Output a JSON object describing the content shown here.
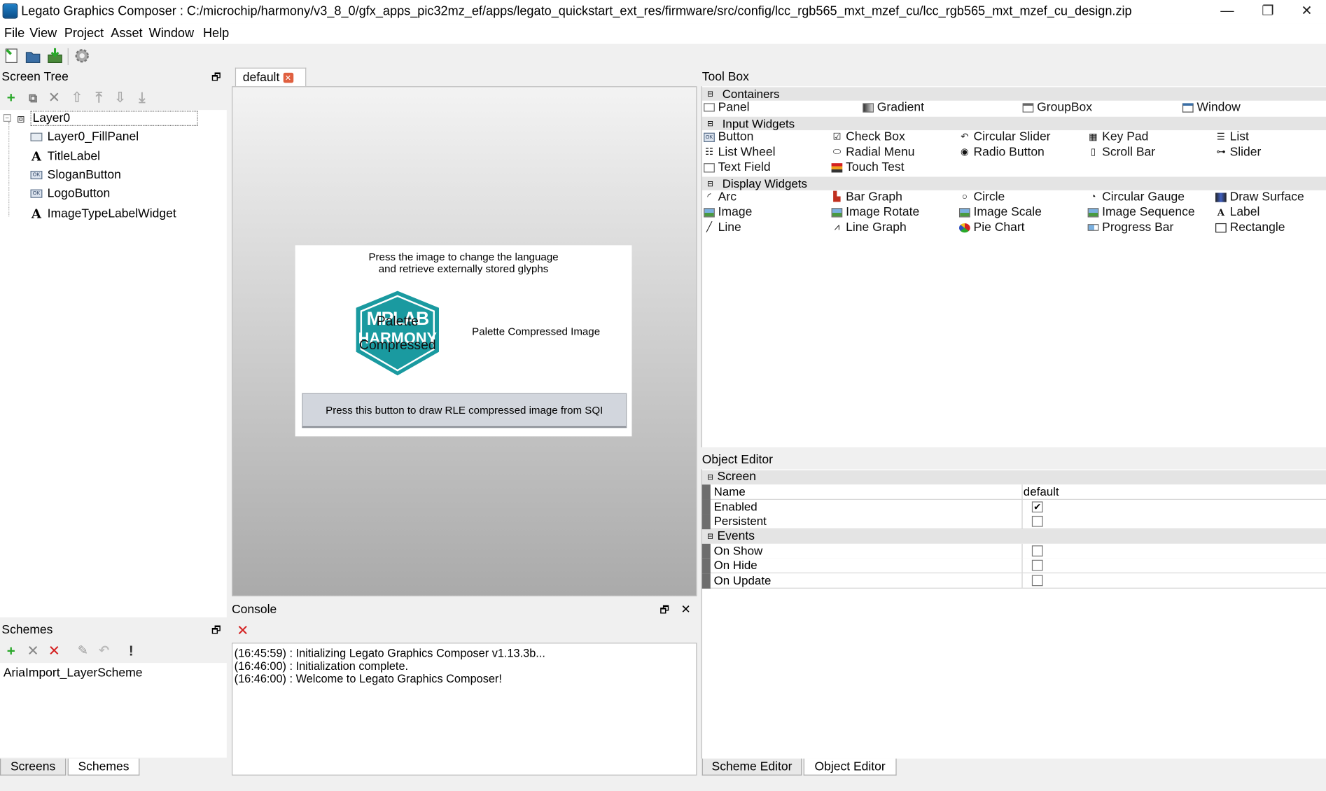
{
  "window": {
    "title": "Legato Graphics Composer : C:/microchip/harmony/v3_8_0/gfx_apps_pic32mz_ef/apps/legato_quickstart_ext_res/firmware/src/config/lcc_rgb565_mxt_mzef_cu/lcc_rgb565_mxt_mzef_cu_design.zip",
    "minimize": "—",
    "restore": "❐",
    "close": "✕"
  },
  "menu": [
    "File",
    "View",
    "Project",
    "Asset",
    "Window",
    "Help"
  ],
  "screen_tree": {
    "title": "Screen Tree",
    "nodes": [
      {
        "label": "Layer0",
        "icon": "layer-icon"
      },
      {
        "label": "Layer0_FillPanel",
        "icon": "panel-icon"
      },
      {
        "label": "TitleLabel",
        "icon": "label-icon"
      },
      {
        "label": "SloganButton",
        "icon": "button-icon"
      },
      {
        "label": "LogoButton",
        "icon": "button-icon"
      },
      {
        "label": "ImageTypeLabelWidget",
        "icon": "label-icon"
      }
    ]
  },
  "schemes": {
    "title": "Schemes",
    "items": [
      "AriaImport_LayerScheme"
    ]
  },
  "left_tabs": [
    "Screens",
    "Schemes"
  ],
  "editor": {
    "tab": "default",
    "preview": {
      "title_line1": "Press the image to change the language",
      "title_line2": "and retrieve externally stored glyphs",
      "logo_text_top": "MPLAB",
      "logo_text_bottom": "HARMONY",
      "logo_overlay_1": "Palette",
      "logo_overlay_2": "Compressed",
      "image_type_label": "Palette Compressed Image",
      "button_label": "Press this button to draw RLE compressed image from SQI"
    }
  },
  "console": {
    "title": "Console",
    "lines": [
      "(16:45:59) : Initializing Legato Graphics Composer v1.13.3b...",
      "(16:46:00) : Initialization complete.",
      "(16:46:00) : Welcome to Legato Graphics Composer!"
    ]
  },
  "toolbox": {
    "title": "Tool Box",
    "sections": [
      {
        "name": "Containers",
        "items": [
          "Panel",
          "Gradient",
          "GroupBox",
          "Window"
        ]
      },
      {
        "name": "Input Widgets",
        "items": [
          "Button",
          "Check Box",
          "Circular Slider",
          "Key Pad",
          "List",
          "List Wheel",
          "Radial Menu",
          "Radio Button",
          "Scroll Bar",
          "Slider",
          "Text Field",
          "Touch Test"
        ]
      },
      {
        "name": "Display Widgets",
        "items": [
          "Arc",
          "Bar Graph",
          "Circle",
          "Circular Gauge",
          "Draw Surface",
          "Image",
          "Image Rotate",
          "Image Scale",
          "Image Sequence",
          "Label",
          "Line",
          "Line Graph",
          "Pie Chart",
          "Progress Bar",
          "Rectangle"
        ]
      }
    ]
  },
  "object_editor": {
    "title": "Object Editor",
    "screen_section": "Screen",
    "events_section": "Events",
    "name_key": "Name",
    "name_value": "default",
    "enabled_key": "Enabled",
    "persistent_key": "Persistent",
    "on_show_key": "On Show",
    "on_hide_key": "On Hide",
    "on_update_key": "On Update",
    "check_mark": "✔"
  },
  "right_tabs": [
    "Scheme Editor",
    "Object Editor"
  ],
  "colors": {
    "logo_teal": "#1a9aa0",
    "add_green": "#2aa82a",
    "delete_red": "#d42020"
  }
}
